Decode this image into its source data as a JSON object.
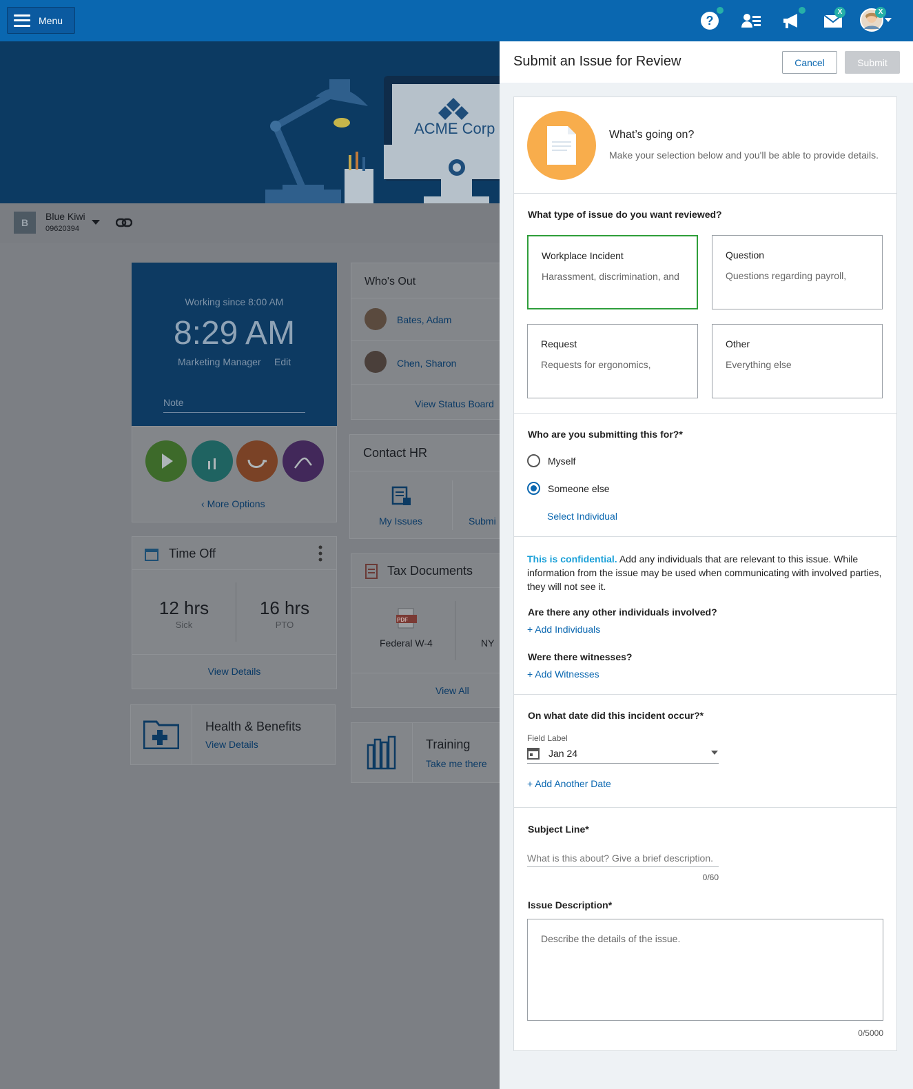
{
  "topbar": {
    "menu_label": "Menu",
    "icons": [
      "help-icon",
      "people-icon",
      "megaphone-icon",
      "inbox-icon",
      "avatar"
    ],
    "inbox_badge": "X",
    "avatar_badge": "X",
    "accent": "#0a67b0"
  },
  "hero": {
    "logo_text": "ACME Corp"
  },
  "employee": {
    "initial": "B",
    "name": "Blue Kiwi",
    "id": "09620394"
  },
  "clock": {
    "since": "Working since 8:00 AM",
    "time": "8:29 AM",
    "role": "Marketing Manager",
    "edit": "Edit",
    "note_placeholder": "Note",
    "more_options": "More Options"
  },
  "whos_out": {
    "title": "Who's Out",
    "people": [
      "Bates, Adam",
      "Chen, Sharon"
    ],
    "link": "View Status Board"
  },
  "contact_hr": {
    "title": "Contact HR",
    "items": [
      "My Issues",
      "Submi"
    ]
  },
  "time_off": {
    "title": "Time Off",
    "sick_value": "12 hrs",
    "sick_label": "Sick",
    "pto_value": "16 hrs",
    "pto_label": "PTO",
    "link": "View Details"
  },
  "tax_docs": {
    "title": "Tax Documents",
    "pdf_badge": "PDF",
    "doc1": "Federal W-4",
    "doc2": "NY",
    "link": "View All"
  },
  "health": {
    "title": "Health & Benefits",
    "link": "View Details"
  },
  "training": {
    "title": "Training",
    "link": "Take me there"
  },
  "panel": {
    "title": "Submit an Issue for Review",
    "cancel": "Cancel",
    "submit": "Submit",
    "intro_title": "What’s going on?",
    "intro_text": "Make your selection below and you'll be able to provide details.",
    "issue_type_q": "What type of issue do you want reviewed?",
    "tiles": [
      {
        "title": "Workplace Incident",
        "desc": "Harassment, discrimination, and"
      },
      {
        "title": "Question",
        "desc": "Questions regarding payroll,"
      },
      {
        "title": "Request",
        "desc": "Requests for ergonomics,"
      },
      {
        "title": "Other",
        "desc": "Everything else"
      }
    ],
    "selected_tile": "Workplace Incident",
    "who_q": "Who are you submitting this for?*",
    "opt_myself": "Myself",
    "opt_someone": "Someone else",
    "selected_option": "Someone else",
    "select_individual": "Select Individual",
    "confidential_lead": "This is confidential.",
    "confidential_text": "Add any individuals that are relevant to this issue. While information from the issue may be used when communicating with involved parties, they will not see it.",
    "others_q": "Are there any other individuals involved?",
    "add_individuals": "+ Add Individuals",
    "witness_q": "Were there witnesses?",
    "add_witnesses": "+ Add Witnesses",
    "date_q": "On what date did this incident occur?*",
    "field_label": "Field Label",
    "date_value": "Jan 24",
    "add_date": "+ Add Another Date",
    "subject_label": "Subject Line*",
    "subject_placeholder": "What is this about? Give a brief description.",
    "subject_count": "0/60",
    "desc_label": "Issue Description*",
    "desc_placeholder": "Describe the details of the issue.",
    "desc_count": "0/5000",
    "colors": {
      "selected_border": "#2e9e3a",
      "link": "#0a67b0",
      "confidential": "#1aa0d8",
      "intro_circle": "#f8ad4c"
    }
  }
}
